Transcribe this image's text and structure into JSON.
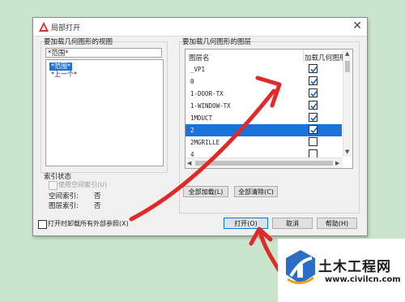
{
  "dialog": {
    "title": "局部打开",
    "close_glyph": "✕"
  },
  "views": {
    "group_label": "要加载几何图形的视图",
    "header": "*范围*",
    "items": [
      {
        "label": "*范围*",
        "selected": true
      },
      {
        "label": "*上一个*",
        "selected": false
      }
    ]
  },
  "index": {
    "group_label": "索引状态",
    "use_spatial_label": "使用空间索引(U)",
    "spatial_label": "空间索引:",
    "spatial_value": "否",
    "layer_label": "图层索引:",
    "layer_value": "否"
  },
  "layers": {
    "group_label": "要加载几何图形的图层",
    "col_name": "图层名",
    "col_load": "加载几何图形",
    "rows": [
      {
        "name": "_VP1",
        "checked": true,
        "selected": false
      },
      {
        "name": "0",
        "checked": true,
        "selected": false
      },
      {
        "name": "1-DOOR-TX",
        "checked": true,
        "selected": false
      },
      {
        "name": "1-WINDOW-TX",
        "checked": true,
        "selected": false
      },
      {
        "name": "1MDUCT",
        "checked": true,
        "selected": false
      },
      {
        "name": "2",
        "checked": true,
        "selected": true
      },
      {
        "name": "2MGRILLE",
        "checked": false,
        "selected": false
      },
      {
        "name": "4",
        "checked": false,
        "selected": false
      }
    ],
    "load_all": "全部加载(L)",
    "clear_all": "全部清除(C)"
  },
  "footer": {
    "unload_xrefs_label": "打开时卸载所有外部参照(X)",
    "open_button": "打开(O)",
    "cancel_button": "取消",
    "help_button": "帮助(H)"
  },
  "watermark": {
    "title": "土木工程网",
    "url": "www.civilcn.com"
  },
  "colors": {
    "selection": "#1a73d9",
    "annotation_arrow": "#e02a2a",
    "background": "#c9e6cd"
  }
}
